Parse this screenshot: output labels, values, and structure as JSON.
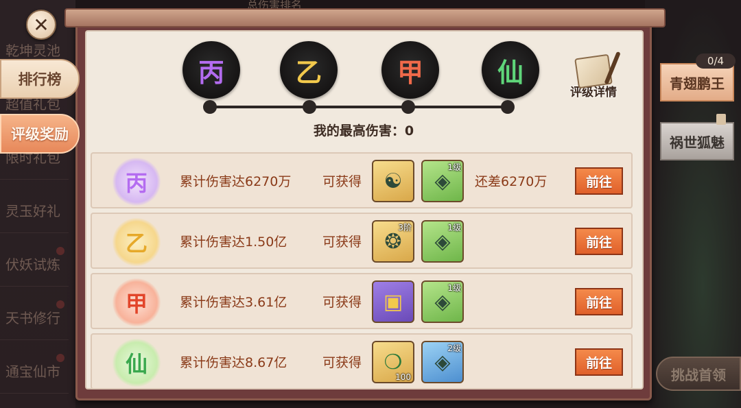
{
  "background": {
    "top_text": "总伤害排名",
    "menu": [
      "乾坤灵池",
      "超值礼包",
      "限时礼包",
      "灵玉好礼",
      "伏妖试炼",
      "天书修行",
      "通宝仙市"
    ]
  },
  "left_tabs": {
    "ranking": "排行榜",
    "rating_reward": "评级奖励"
  },
  "grades": [
    {
      "glyph": "丙",
      "color": "#b46cf0"
    },
    {
      "glyph": "乙",
      "color": "#f2c94c"
    },
    {
      "glyph": "甲",
      "color": "#f06a4a"
    },
    {
      "glyph": "仙",
      "color": "#5fd67a"
    }
  ],
  "rating_detail": "评级详情",
  "my_best": "我的最高伤害：0",
  "rows": [
    {
      "badge": "丙",
      "badge_color": "#b46cf0",
      "badge_bg": "#d6b8f2",
      "target": "累计伤害达6270万",
      "obtain": "可获得",
      "items": [
        {
          "style": "gold",
          "glyph": "☯",
          "tag": "",
          "count": ""
        },
        {
          "style": "green",
          "glyph": "◈",
          "tag": "1级",
          "count": ""
        }
      ],
      "remaining": "还差6270万",
      "go": "前往"
    },
    {
      "badge": "乙",
      "badge_color": "#e6a92a",
      "badge_bg": "#f6d78c",
      "target": "累计伤害达1.50亿",
      "obtain": "可获得",
      "items": [
        {
          "style": "gold",
          "glyph": "❂",
          "tag": "3阶",
          "count": ""
        },
        {
          "style": "green",
          "glyph": "◈",
          "tag": "1级",
          "count": ""
        }
      ],
      "remaining": "",
      "go": "前往"
    },
    {
      "badge": "甲",
      "badge_color": "#e2452a",
      "badge_bg": "#f8b29a",
      "target": "累计伤害达3.61亿",
      "obtain": "可获得",
      "items": [
        {
          "style": "purple",
          "glyph": "▣",
          "tag": "",
          "count": ""
        },
        {
          "style": "green",
          "glyph": "◈",
          "tag": "1级",
          "count": ""
        }
      ],
      "remaining": "",
      "go": "前往"
    },
    {
      "badge": "仙",
      "badge_color": "#3aa84e",
      "badge_bg": "#c8ecae",
      "target": "累计伤害达8.67亿",
      "obtain": "可获得",
      "items": [
        {
          "style": "gold",
          "glyph": "❍",
          "tag": "",
          "count": "100"
        },
        {
          "style": "blue",
          "glyph": "◈",
          "tag": "2级",
          "count": ""
        }
      ],
      "remaining": "",
      "go": "前往"
    }
  ],
  "bosses": {
    "progress": "0/4",
    "boss1": "青翅鹏王",
    "boss2": "祸世狐魅"
  },
  "challenge": "挑战首领"
}
